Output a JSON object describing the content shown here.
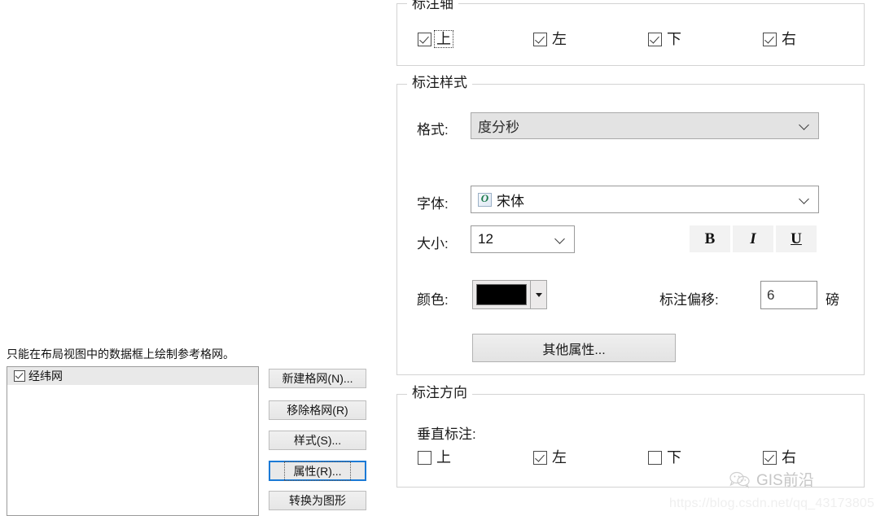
{
  "left_panel": {
    "help_text": "只能在布局视图中的数据框上绘制参考格网。",
    "list": {
      "items": [
        {
          "label": "经纬网",
          "checked": true,
          "selected": true
        }
      ]
    },
    "buttons": [
      {
        "label": "新建格网(N)...",
        "accel": "N",
        "focused": false
      },
      {
        "label": "移除格网(R)",
        "accel": "R",
        "focused": false
      },
      {
        "label": "样式(S)...",
        "accel": "S",
        "focused": false
      },
      {
        "label": "属性(R)...",
        "accel": "R",
        "focused": true
      },
      {
        "label": "转换为图形",
        "accel": "",
        "focused": false
      }
    ]
  },
  "label_axes_group": {
    "title": "标注轴",
    "checkboxes": [
      {
        "label": "上",
        "checked": true,
        "focused": true
      },
      {
        "label": "左",
        "checked": true,
        "focused": false
      },
      {
        "label": "下",
        "checked": true,
        "focused": false
      },
      {
        "label": "右",
        "checked": true,
        "focused": false
      }
    ]
  },
  "label_style_group": {
    "title": "标注样式",
    "format_label": "格式:",
    "format_value": "度分秒",
    "font_label": "字体:",
    "font_value": "宋体",
    "font_icon": "opentype-font-icon",
    "size_label": "大小:",
    "size_value": "12",
    "bold_label": "B",
    "italic_label": "I",
    "underline_label": "U",
    "color_label": "颜色:",
    "color_value": "#000000",
    "offset_label": "标注偏移:",
    "offset_value": "6",
    "offset_unit": "磅",
    "more_properties_label": "其他属性..."
  },
  "label_direction_group": {
    "title": "标注方向",
    "vertical_label": "垂直标注:",
    "checkboxes": [
      {
        "label": "上",
        "checked": false
      },
      {
        "label": "左",
        "checked": true
      },
      {
        "label": "下",
        "checked": false
      },
      {
        "label": "右",
        "checked": true
      }
    ]
  },
  "watermark": {
    "brand": "GIS前沿",
    "url": "https://blog.csdn.net/qq_43173805"
  }
}
